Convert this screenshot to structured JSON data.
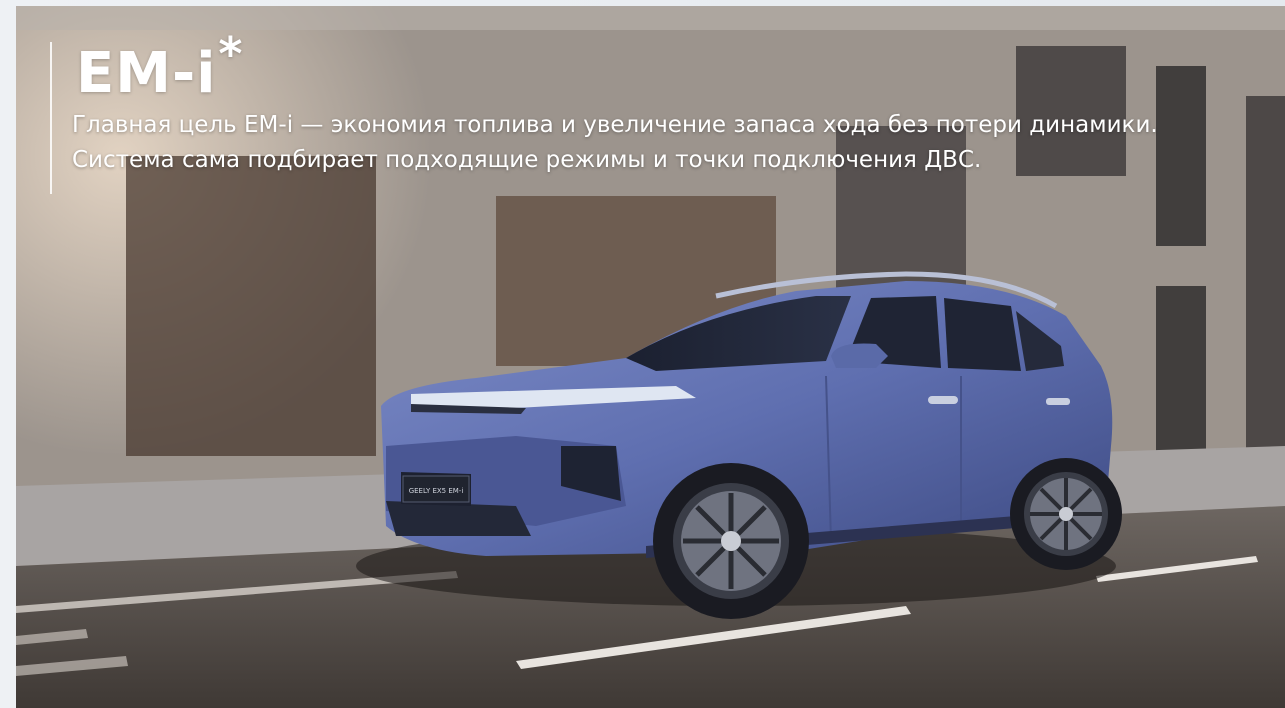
{
  "hero": {
    "title": "EM-i",
    "title_mark": "*",
    "description": "Главная цель EM-i — экономия топлива и увеличение запаса хода без потери динамики. Система сама подбирает подходящие режимы и точки подключения ДВС.",
    "image_label": "GEELY EX5 EM-i",
    "colors": {
      "car_body": "#5f6fb0",
      "text": "#ffffff"
    }
  }
}
